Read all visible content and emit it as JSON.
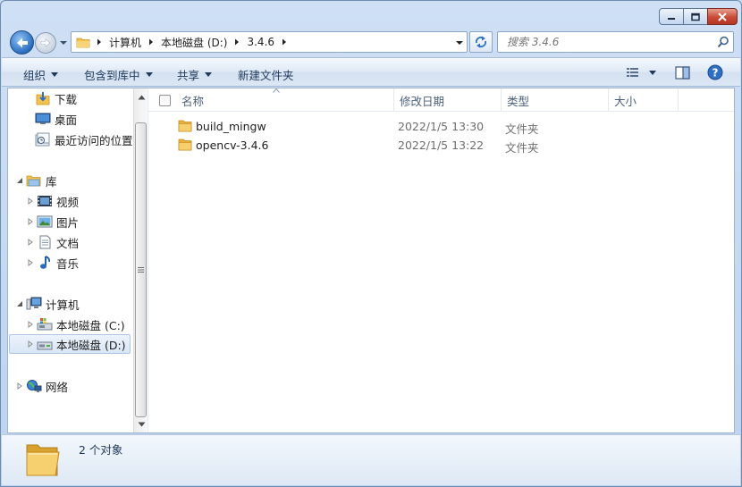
{
  "address": {
    "crumbs": [
      "计算机",
      "本地磁盘 (D:)",
      "3.4.6"
    ]
  },
  "search": {
    "placeholder": "搜索 3.4.6"
  },
  "toolbar": {
    "organize": "组织",
    "include_in_library": "包含到库中",
    "share": "共享",
    "new_folder": "新建文件夹"
  },
  "nav": {
    "favorites": [
      {
        "label": "下载",
        "icon": "download-folder-icon"
      },
      {
        "label": "桌面",
        "icon": "desktop-icon"
      },
      {
        "label": "最近访问的位置",
        "icon": "recent-places-icon"
      }
    ],
    "libraries_label": "库",
    "libraries": [
      {
        "label": "视频",
        "icon": "video-library-icon"
      },
      {
        "label": "图片",
        "icon": "pictures-library-icon"
      },
      {
        "label": "文档",
        "icon": "documents-library-icon"
      },
      {
        "label": "音乐",
        "icon": "music-library-icon"
      }
    ],
    "computer_label": "计算机",
    "drives": [
      {
        "label": "本地磁盘 (C:)",
        "icon": "system-drive-icon"
      },
      {
        "label": "本地磁盘 (D:)",
        "icon": "drive-icon",
        "selected": true
      }
    ],
    "network_label": "网络"
  },
  "columns": {
    "name": "名称",
    "modified": "修改日期",
    "type": "类型",
    "size": "大小"
  },
  "files": [
    {
      "name": "build_mingw",
      "modified": "2022/1/5 13:30",
      "type": "文件夹",
      "size": ""
    },
    {
      "name": "opencv-3.4.6",
      "modified": "2022/1/5 13:22",
      "type": "文件夹",
      "size": ""
    }
  ],
  "status": {
    "item_count": "2 个对象"
  },
  "colors": {
    "folder": "#f2c14e",
    "accent": "#2b6cc0",
    "close": "#c84a37"
  }
}
